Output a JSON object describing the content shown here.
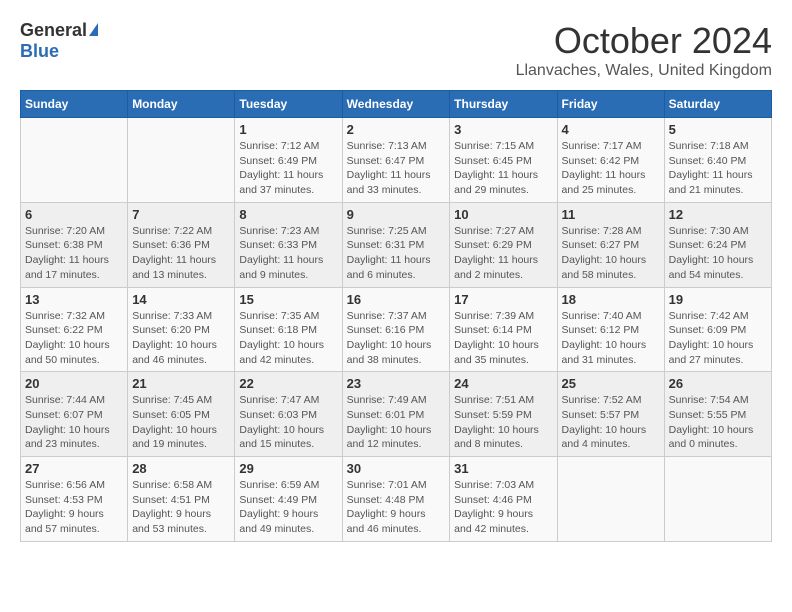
{
  "header": {
    "logo_general": "General",
    "logo_blue": "Blue",
    "month": "October 2024",
    "location": "Llanvaches, Wales, United Kingdom"
  },
  "days_of_week": [
    "Sunday",
    "Monday",
    "Tuesday",
    "Wednesday",
    "Thursday",
    "Friday",
    "Saturday"
  ],
  "weeks": [
    [
      {
        "day": "",
        "info": ""
      },
      {
        "day": "",
        "info": ""
      },
      {
        "day": "1",
        "info": "Sunrise: 7:12 AM\nSunset: 6:49 PM\nDaylight: 11 hours and 37 minutes."
      },
      {
        "day": "2",
        "info": "Sunrise: 7:13 AM\nSunset: 6:47 PM\nDaylight: 11 hours and 33 minutes."
      },
      {
        "day": "3",
        "info": "Sunrise: 7:15 AM\nSunset: 6:45 PM\nDaylight: 11 hours and 29 minutes."
      },
      {
        "day": "4",
        "info": "Sunrise: 7:17 AM\nSunset: 6:42 PM\nDaylight: 11 hours and 25 minutes."
      },
      {
        "day": "5",
        "info": "Sunrise: 7:18 AM\nSunset: 6:40 PM\nDaylight: 11 hours and 21 minutes."
      }
    ],
    [
      {
        "day": "6",
        "info": "Sunrise: 7:20 AM\nSunset: 6:38 PM\nDaylight: 11 hours and 17 minutes."
      },
      {
        "day": "7",
        "info": "Sunrise: 7:22 AM\nSunset: 6:36 PM\nDaylight: 11 hours and 13 minutes."
      },
      {
        "day": "8",
        "info": "Sunrise: 7:23 AM\nSunset: 6:33 PM\nDaylight: 11 hours and 9 minutes."
      },
      {
        "day": "9",
        "info": "Sunrise: 7:25 AM\nSunset: 6:31 PM\nDaylight: 11 hours and 6 minutes."
      },
      {
        "day": "10",
        "info": "Sunrise: 7:27 AM\nSunset: 6:29 PM\nDaylight: 11 hours and 2 minutes."
      },
      {
        "day": "11",
        "info": "Sunrise: 7:28 AM\nSunset: 6:27 PM\nDaylight: 10 hours and 58 minutes."
      },
      {
        "day": "12",
        "info": "Sunrise: 7:30 AM\nSunset: 6:24 PM\nDaylight: 10 hours and 54 minutes."
      }
    ],
    [
      {
        "day": "13",
        "info": "Sunrise: 7:32 AM\nSunset: 6:22 PM\nDaylight: 10 hours and 50 minutes."
      },
      {
        "day": "14",
        "info": "Sunrise: 7:33 AM\nSunset: 6:20 PM\nDaylight: 10 hours and 46 minutes."
      },
      {
        "day": "15",
        "info": "Sunrise: 7:35 AM\nSunset: 6:18 PM\nDaylight: 10 hours and 42 minutes."
      },
      {
        "day": "16",
        "info": "Sunrise: 7:37 AM\nSunset: 6:16 PM\nDaylight: 10 hours and 38 minutes."
      },
      {
        "day": "17",
        "info": "Sunrise: 7:39 AM\nSunset: 6:14 PM\nDaylight: 10 hours and 35 minutes."
      },
      {
        "day": "18",
        "info": "Sunrise: 7:40 AM\nSunset: 6:12 PM\nDaylight: 10 hours and 31 minutes."
      },
      {
        "day": "19",
        "info": "Sunrise: 7:42 AM\nSunset: 6:09 PM\nDaylight: 10 hours and 27 minutes."
      }
    ],
    [
      {
        "day": "20",
        "info": "Sunrise: 7:44 AM\nSunset: 6:07 PM\nDaylight: 10 hours and 23 minutes."
      },
      {
        "day": "21",
        "info": "Sunrise: 7:45 AM\nSunset: 6:05 PM\nDaylight: 10 hours and 19 minutes."
      },
      {
        "day": "22",
        "info": "Sunrise: 7:47 AM\nSunset: 6:03 PM\nDaylight: 10 hours and 15 minutes."
      },
      {
        "day": "23",
        "info": "Sunrise: 7:49 AM\nSunset: 6:01 PM\nDaylight: 10 hours and 12 minutes."
      },
      {
        "day": "24",
        "info": "Sunrise: 7:51 AM\nSunset: 5:59 PM\nDaylight: 10 hours and 8 minutes."
      },
      {
        "day": "25",
        "info": "Sunrise: 7:52 AM\nSunset: 5:57 PM\nDaylight: 10 hours and 4 minutes."
      },
      {
        "day": "26",
        "info": "Sunrise: 7:54 AM\nSunset: 5:55 PM\nDaylight: 10 hours and 0 minutes."
      }
    ],
    [
      {
        "day": "27",
        "info": "Sunrise: 6:56 AM\nSunset: 4:53 PM\nDaylight: 9 hours and 57 minutes."
      },
      {
        "day": "28",
        "info": "Sunrise: 6:58 AM\nSunset: 4:51 PM\nDaylight: 9 hours and 53 minutes."
      },
      {
        "day": "29",
        "info": "Sunrise: 6:59 AM\nSunset: 4:49 PM\nDaylight: 9 hours and 49 minutes."
      },
      {
        "day": "30",
        "info": "Sunrise: 7:01 AM\nSunset: 4:48 PM\nDaylight: 9 hours and 46 minutes."
      },
      {
        "day": "31",
        "info": "Sunrise: 7:03 AM\nSunset: 4:46 PM\nDaylight: 9 hours and 42 minutes."
      },
      {
        "day": "",
        "info": ""
      },
      {
        "day": "",
        "info": ""
      }
    ]
  ]
}
